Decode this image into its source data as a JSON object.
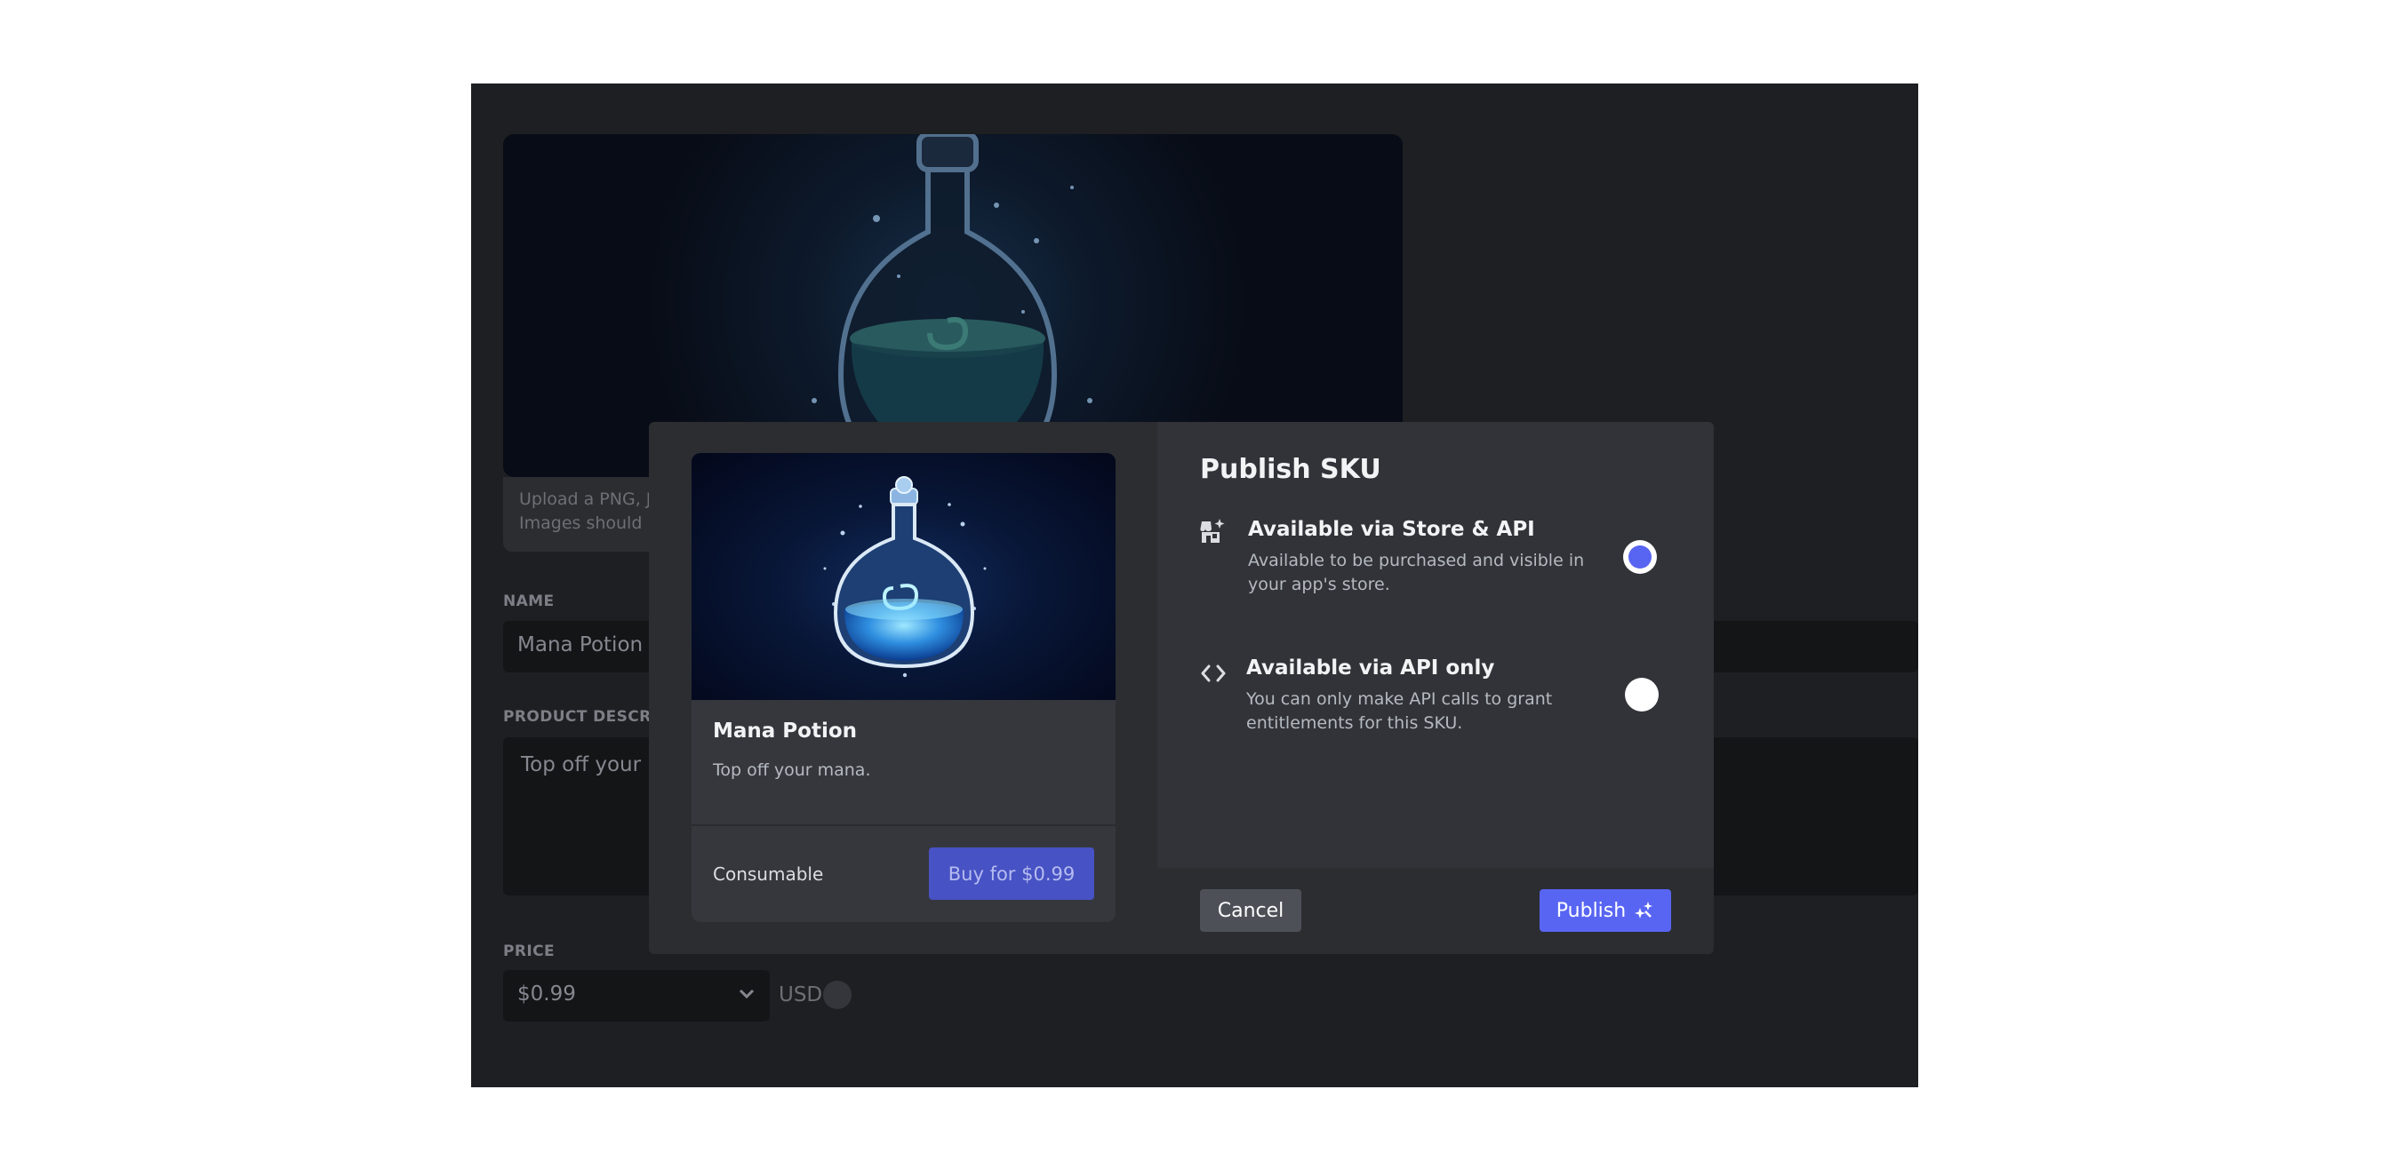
{
  "background": {
    "upload_hint_line1": "Upload a PNG, JPG",
    "upload_hint_line2": "Images should be",
    "name_label": "NAME",
    "name_value": "Mana Potion",
    "description_label": "PRODUCT DESCRIPT",
    "description_value": "Top off your m",
    "price_label": "PRICE",
    "price_value": "$0.99",
    "currency": "USD"
  },
  "preview_card": {
    "title": "Mana Potion",
    "description": "Top off your mana.",
    "type": "Consumable",
    "buy_label": "Buy for $0.99"
  },
  "modal": {
    "title": "Publish SKU",
    "options": [
      {
        "title": "Available via Store & API",
        "description": "Available to be purchased and visible in your app's store.",
        "icon": "store-icon",
        "selected": true
      },
      {
        "title": "Available via API only",
        "description": "You can only make API calls to grant entitlements for this SKU.",
        "icon": "code-icon",
        "selected": false
      }
    ],
    "cancel_label": "Cancel",
    "publish_label": "Publish"
  },
  "colors": {
    "accent": "#5865f2",
    "buy_button": "#4752c4",
    "modal_left_bg": "#2b2d31",
    "modal_right_bg": "#313338"
  }
}
